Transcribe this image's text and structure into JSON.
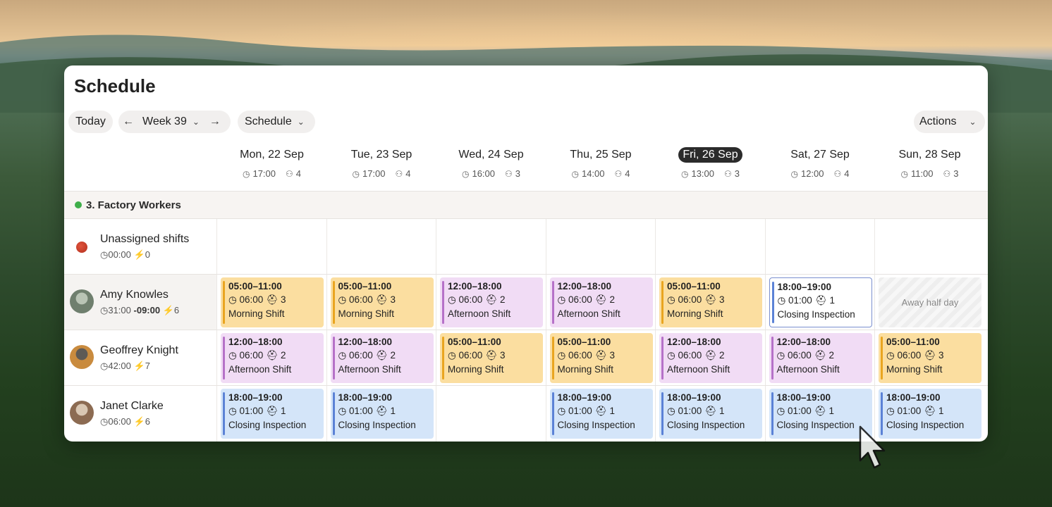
{
  "title": "Schedule",
  "toolbar": {
    "today": "Today",
    "prev_icon": "arrow-left-icon",
    "week": "Week 39",
    "next_icon": "arrow-right-icon",
    "view": "Schedule",
    "actions": "Actions"
  },
  "days": [
    {
      "label": "Mon, 22 Sep",
      "hours": "17:00",
      "people": "4"
    },
    {
      "label": "Tue, 23 Sep",
      "hours": "17:00",
      "people": "4"
    },
    {
      "label": "Wed, 24 Sep",
      "hours": "16:00",
      "people": "3"
    },
    {
      "label": "Thu, 25 Sep",
      "hours": "14:00",
      "people": "4"
    },
    {
      "label": "Fri, 26 Sep",
      "hours": "13:00",
      "people": "3",
      "today": true
    },
    {
      "label": "Sat, 27 Sep",
      "hours": "12:00",
      "people": "4"
    },
    {
      "label": "Sun, 28 Sep",
      "hours": "11:00",
      "people": "3"
    }
  ],
  "group": {
    "label": "3. Factory Workers",
    "color": "#3fae4a"
  },
  "rows": [
    {
      "name": "Unassigned shifts",
      "hours": "00:00",
      "delta": "",
      "count": "0"
    },
    {
      "name": "Amy Knowles",
      "hours": "31:00",
      "delta": "-09:00",
      "count": "6"
    },
    {
      "name": "Geoffrey Knight",
      "hours": "42:00",
      "delta": "",
      "count": "7"
    },
    {
      "name": "Janet Clarke",
      "hours": "06:00",
      "delta": "",
      "count": "6"
    }
  ],
  "shift_types": {
    "morning": {
      "time": "05:00–11:00",
      "dur": "06:00",
      "n": "3",
      "name": "Morning Shift"
    },
    "afternoon": {
      "time": "12:00–18:00",
      "dur": "06:00",
      "n": "2",
      "name": "Afternoon Shift"
    },
    "closing": {
      "time": "18:00–19:00",
      "dur": "01:00",
      "n": "1",
      "name": "Closing Inspection"
    }
  },
  "away_label": "Away half day",
  "colors": {
    "morning": "#fbdea0",
    "afternoon": "#f1dcf5",
    "closing": "#d4e5f9"
  }
}
